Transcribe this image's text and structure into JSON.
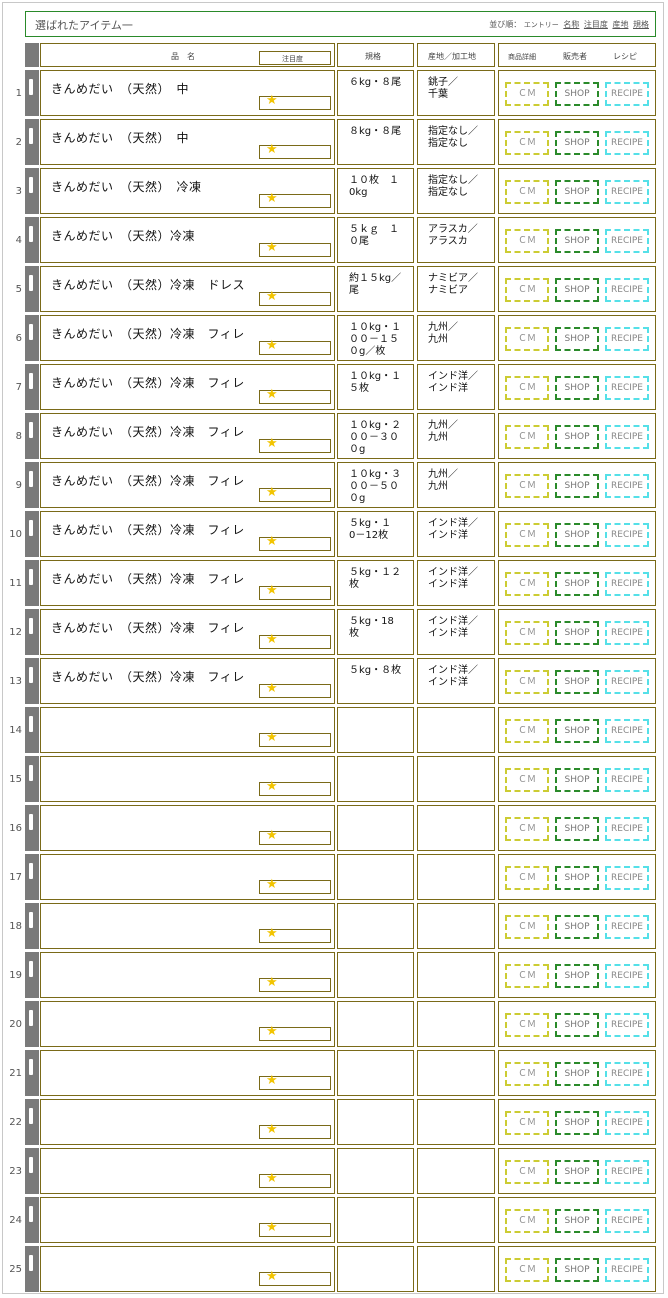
{
  "title": "選ばれたアイテム一",
  "sort": {
    "label": "並び順：",
    "entry": "エントリー",
    "options": [
      "名称",
      "注目度",
      "産地",
      "規格"
    ]
  },
  "header": {
    "name": "品　名",
    "attention": "注目度",
    "spec": "規格",
    "origin": "産地／加工地",
    "detail": "商品詳細",
    "seller": "販売者",
    "recipe": "レシピ"
  },
  "buttons": {
    "cm": "ＣＭ",
    "shop": "SHOP",
    "recipe": "RECIPE"
  },
  "star": "★",
  "rows": [
    {
      "num": "1",
      "name": "きんめだい　（天然）　中",
      "spec": "６kg・８尾",
      "origin": "銚子／\n千葉"
    },
    {
      "num": "2",
      "name": "きんめだい　（天然）　中",
      "spec": "８kg・８尾",
      "origin": "指定なし／\n指定なし"
    },
    {
      "num": "3",
      "name": "きんめだい　（天然）　冷凍",
      "spec": "１０枚　１\n0kg",
      "origin": "指定なし／\n指定なし"
    },
    {
      "num": "4",
      "name": "きんめだい　（天然）冷凍",
      "spec": "５ｋｇ　１\n０尾",
      "origin": "アラスカ／\nアラスカ"
    },
    {
      "num": "5",
      "name": "きんめだい　（天然）冷凍　ドレス",
      "spec": "約１５kg／\n尾",
      "origin": "ナミビア／\nナミビア"
    },
    {
      "num": "6",
      "name": "きんめだい　（天然）冷凍　フィレ",
      "spec": "１０kg・１\n００－１５\n０g／枚",
      "origin": "九州／\n九州"
    },
    {
      "num": "7",
      "name": "きんめだい　（天然）冷凍　フィレ",
      "spec": "１０kg・１\n５枚",
      "origin": "インド洋／\nインド洋"
    },
    {
      "num": "8",
      "name": "きんめだい　（天然）冷凍　フィレ",
      "spec": "１０kg・２\n００－３０\n０g",
      "origin": "九州／\n九州"
    },
    {
      "num": "9",
      "name": "きんめだい　（天然）冷凍　フィレ",
      "spec": "１０kg・３\n００－５０\n０g",
      "origin": "九州／\n九州"
    },
    {
      "num": "10",
      "name": "きんめだい　（天然）冷凍　フィレ",
      "spec": "５kg・１\n0－12枚",
      "origin": "インド洋／\nインド洋"
    },
    {
      "num": "11",
      "name": "きんめだい　（天然）冷凍　フィレ",
      "spec": "５kg・１２\n枚",
      "origin": "インド洋／\nインド洋"
    },
    {
      "num": "12",
      "name": "きんめだい　（天然）冷凍　フィレ",
      "spec": "５kg・18\n枚",
      "origin": "インド洋／\nインド洋"
    },
    {
      "num": "13",
      "name": "きんめだい　（天然）冷凍　フィレ",
      "spec": "５kg・８枚",
      "origin": "インド洋／\nインド洋"
    },
    {
      "num": "14",
      "name": "",
      "spec": "",
      "origin": ""
    },
    {
      "num": "15",
      "name": "",
      "spec": "",
      "origin": ""
    },
    {
      "num": "16",
      "name": "",
      "spec": "",
      "origin": ""
    },
    {
      "num": "17",
      "name": "",
      "spec": "",
      "origin": ""
    },
    {
      "num": "18",
      "name": "",
      "spec": "",
      "origin": ""
    },
    {
      "num": "19",
      "name": "",
      "spec": "",
      "origin": ""
    },
    {
      "num": "20",
      "name": "",
      "spec": "",
      "origin": ""
    },
    {
      "num": "21",
      "name": "",
      "spec": "",
      "origin": ""
    },
    {
      "num": "22",
      "name": "",
      "spec": "",
      "origin": ""
    },
    {
      "num": "23",
      "name": "",
      "spec": "",
      "origin": ""
    },
    {
      "num": "24",
      "name": "",
      "spec": "",
      "origin": ""
    },
    {
      "num": "25",
      "name": "",
      "spec": "",
      "origin": ""
    }
  ],
  "colors": {
    "frame_green": "#2a8a2a",
    "cell_border": "#7a6a18",
    "grip": "#7a7a7a",
    "star": "#f2c400",
    "cm": "#cccc33",
    "shop": "#2a8a2a",
    "recipe": "#55e0e8"
  }
}
